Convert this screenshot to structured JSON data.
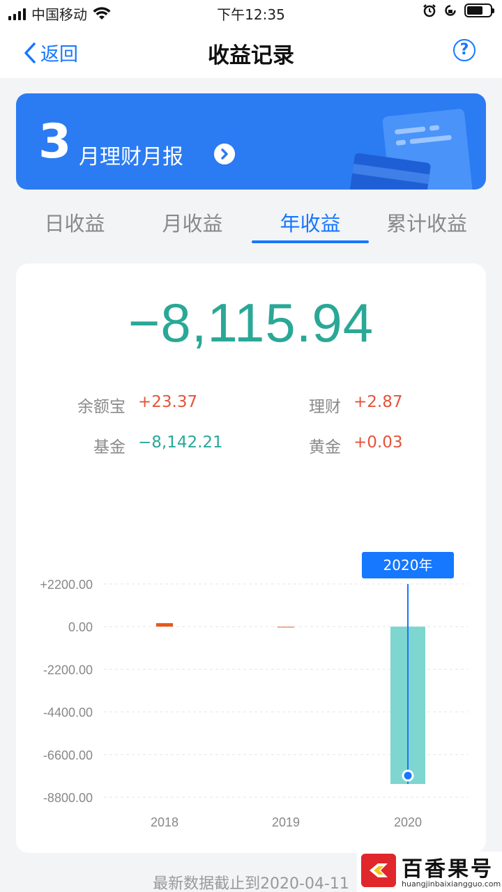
{
  "status_bar": {
    "carrier": "中国移动",
    "time": "下午12:35"
  },
  "nav": {
    "back_label": "返回",
    "title": "收益记录",
    "help_glyph": "?"
  },
  "banner": {
    "month_number": "3",
    "label": "月理财月报"
  },
  "tabs": [
    {
      "label": "日收益",
      "active": false
    },
    {
      "label": "月收益",
      "active": false
    },
    {
      "label": "年收益",
      "active": true
    },
    {
      "label": "累计收益",
      "active": false
    }
  ],
  "summary": {
    "total": "−8,115.94",
    "items": [
      {
        "name": "余额宝",
        "value": "+23.37"
      },
      {
        "name": "理财",
        "value": "+2.87"
      },
      {
        "name": "基金",
        "value": "−8,142.21"
      },
      {
        "name": "黄金",
        "value": "+0.03"
      }
    ]
  },
  "chart_data": {
    "type": "bar",
    "categories": [
      "2018",
      "2019",
      "2020"
    ],
    "values": [
      180,
      10,
      -8115.94
    ],
    "y_ticks": [
      "+2200.00",
      "0.00",
      "-2200.00",
      "-4400.00",
      "-6600.00",
      "-8800.00"
    ],
    "ylim": [
      -8800,
      2200
    ],
    "selected_label": "2020年",
    "colors": {
      "positive": "#e8571c",
      "negative": "#7dd6cf",
      "tooltip": "#1677ff"
    }
  },
  "footer": {
    "note": "最新数据截止到2020-04-11"
  },
  "watermark": {
    "name": "百香果号",
    "url": "huangjinbaixiangguo.com"
  }
}
